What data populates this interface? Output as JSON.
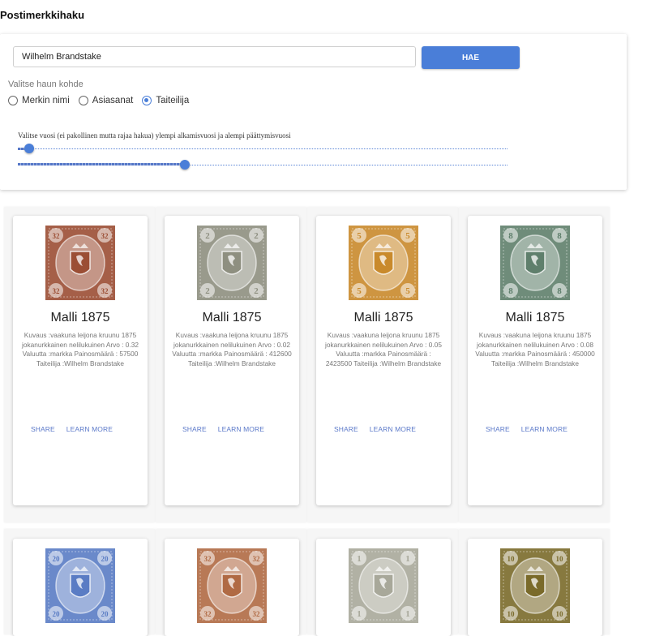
{
  "page_title": "Postimerkkihaku",
  "search": {
    "value": "Wilhelm Brandstake",
    "button_label": "HAE",
    "target_label": "Valitse haun kohde",
    "options": [
      {
        "label": "Merkin nimi",
        "checked": false
      },
      {
        "label": "Asiasanat",
        "checked": false
      },
      {
        "label": "Taiteilija",
        "checked": true
      }
    ]
  },
  "year_filter": {
    "label": "Valitse vuosi (ei pakollinen mutta rajaa hakua) ylempi alkamisvuosi ja alempi päättymisvuosi"
  },
  "cards": [
    {
      "title": "Malli 1875",
      "description": "Kuvaus :vaakuna leijona kruunu 1875 jokanurkkainen nelilukuinen Arvo : 0.32 Valuutta :markka Painosmäärä : 57500 Taiteilija :Wilhelm Brandstake",
      "share_label": "SHARE",
      "learn_label": "LEARN MORE",
      "stamp_color": "#9b4e34",
      "stamp_value": "32"
    },
    {
      "title": "Malli 1875",
      "description": "Kuvaus :vaakuna leijona kruunu 1875 jokanurkkainen nelilukuinen Arvo : 0.02 Valuutta :markka Painosmäärä : 412600 Taiteilija :Wilhelm Brandstake",
      "share_label": "SHARE",
      "learn_label": "LEARN MORE",
      "stamp_color": "#8e8f80",
      "stamp_value": "2"
    },
    {
      "title": "Malli 1875",
      "description": "Kuvaus :vaakuna leijona kruunu 1875 jokanurkkainen nelilukuinen Arvo : 0.05 Valuutta :markka Painosmäärä : 2423500 Taiteilija :Wilhelm Brandstake",
      "share_label": "SHARE",
      "learn_label": "LEARN MORE",
      "stamp_color": "#c98a2c",
      "stamp_value": "5"
    },
    {
      "title": "Malli 1875",
      "description": "Kuvaus :vaakuna leijona kruunu 1875 jokanurkkainen nelilukuinen Arvo : 0.08 Valuutta :markka Painosmäärä : 450000 Taiteilija :Wilhelm Brandstake",
      "share_label": "SHARE",
      "learn_label": "LEARN MORE",
      "stamp_color": "#5f7f6c",
      "stamp_value": "8"
    }
  ],
  "second_row": [
    {
      "stamp_color": "#5a7cc4",
      "stamp_value": "20"
    },
    {
      "stamp_color": "#b06a44",
      "stamp_value": "32"
    },
    {
      "stamp_color": "#a8a89a",
      "stamp_value": "1"
    },
    {
      "stamp_color": "#7a6a2a",
      "stamp_value": "10"
    }
  ]
}
